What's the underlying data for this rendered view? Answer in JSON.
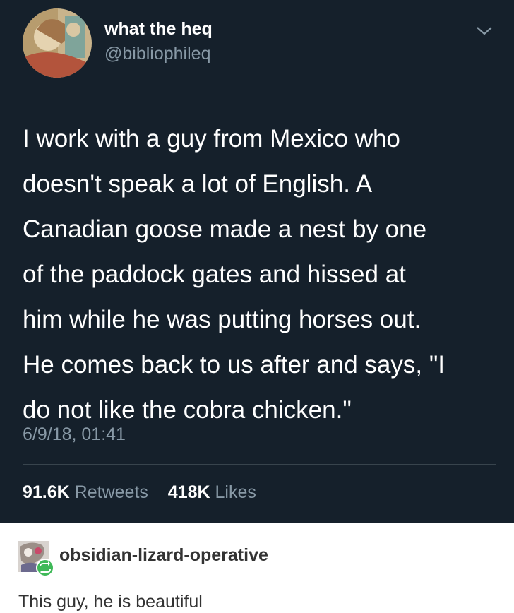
{
  "tweet": {
    "author_name": "what the heq",
    "author_handle": "@bibliophileq",
    "body_lines": [
      "I work with a guy from Mexico who",
      "doesn't speak a lot of English. A",
      "Canadian goose made a nest by one",
      "of the paddock gates and hissed at",
      "him while he was putting horses out.",
      "He comes back to us after and says, \"I",
      "do not like the cobra chicken.\""
    ],
    "timestamp": "6/9/18, 01:41",
    "retweets_count": "91.6K",
    "retweets_label": "Retweets",
    "likes_count": "418K",
    "likes_label": "Likes"
  },
  "reblog": {
    "username": "obsidian-lizard-operative",
    "comment": "This guy, he is beautiful"
  },
  "colors": {
    "tweet_background": "#15202b",
    "secondary_text": "#8899a6",
    "reblog_badge": "#3fb958"
  },
  "icons": [
    "profile-avatar",
    "chevron-down-icon",
    "reblog-icon"
  ]
}
